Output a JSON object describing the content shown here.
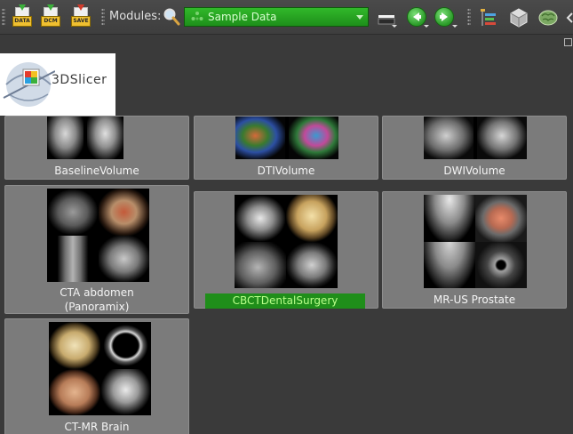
{
  "toolbar": {
    "data_button": "DATA",
    "dcm_button": "DCM",
    "save_button": "SAVE",
    "modules_label": "Modules:",
    "module_select": "Sample Data"
  },
  "logo": {
    "text": "3DSlicer"
  },
  "samples": [
    {
      "label": "BaselineVolume"
    },
    {
      "label": "DTIVolume"
    },
    {
      "label": "DWIVolume"
    },
    {
      "label": "CTA abdomen",
      "sublabel": "(Panoramix)"
    },
    {
      "label": "CBCTDentalSurgery"
    },
    {
      "label": "MR-US Prostate"
    },
    {
      "label": "CT-MR Brain"
    }
  ],
  "colors": {
    "accent": "#1f8e1a",
    "selected_text": "#b9ff8a"
  }
}
